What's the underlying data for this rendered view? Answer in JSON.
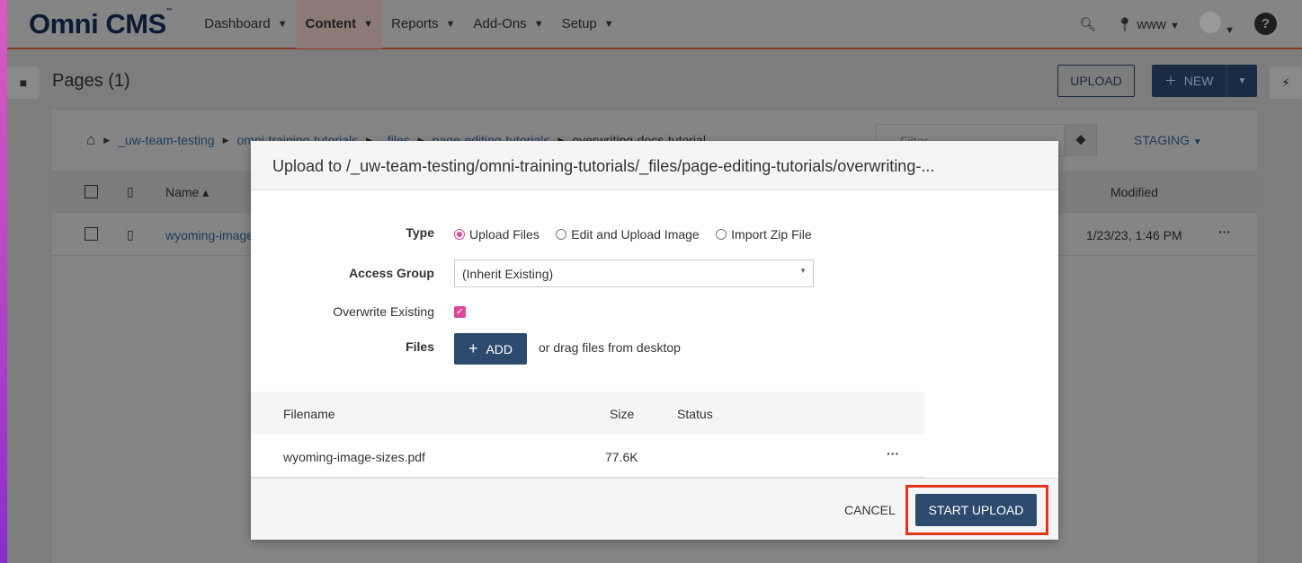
{
  "brand": {
    "logo": "Omni CMS",
    "tm": "™"
  },
  "nav": [
    {
      "label": "Dashboard"
    },
    {
      "label": "Content",
      "active": true
    },
    {
      "label": "Reports"
    },
    {
      "label": "Add-Ons"
    },
    {
      "label": "Setup"
    }
  ],
  "header": {
    "site": "www"
  },
  "page": {
    "title": "Pages (1)",
    "upload_label": "UPLOAD",
    "new_label": "NEW",
    "filter_placeholder": "Filter",
    "staging_label": "STAGING"
  },
  "breadcrumb": [
    "_uw-team-testing",
    "omni-training-tutorials",
    "_files",
    "page-editing-tutorials",
    "overwriting-docs-tutorial"
  ],
  "table": {
    "headers": {
      "name": "Name",
      "modified": "Modified"
    },
    "rows": [
      {
        "name": "wyoming-image-sizes.pdf",
        "modified": "1/23/23, 1:46 PM"
      }
    ]
  },
  "modal": {
    "title": "Upload to /_uw-team-testing/omni-training-tutorials/_files/page-editing-tutorials/overwriting-...",
    "type_label": "Type",
    "type_options": [
      {
        "label": "Upload Files",
        "selected": true
      },
      {
        "label": "Edit and Upload Image",
        "selected": false
      },
      {
        "label": "Import Zip File",
        "selected": false
      }
    ],
    "access_label": "Access Group",
    "access_value": "(Inherit Existing)",
    "overwrite_label": "Overwrite Existing",
    "overwrite_checked": true,
    "files_label": "Files",
    "add_label": "ADD",
    "drag_text": "or drag files from desktop",
    "file_headers": {
      "filename": "Filename",
      "size": "Size",
      "status": "Status"
    },
    "files": [
      {
        "filename": "wyoming-image-sizes.pdf",
        "size": "77.6K",
        "status": ""
      }
    ],
    "cancel_label": "CANCEL",
    "start_label": "START UPLOAD"
  },
  "colors": {
    "accent": "#2d4a6e",
    "checkbox": "#e0479b",
    "highlight": "#e5341d"
  }
}
